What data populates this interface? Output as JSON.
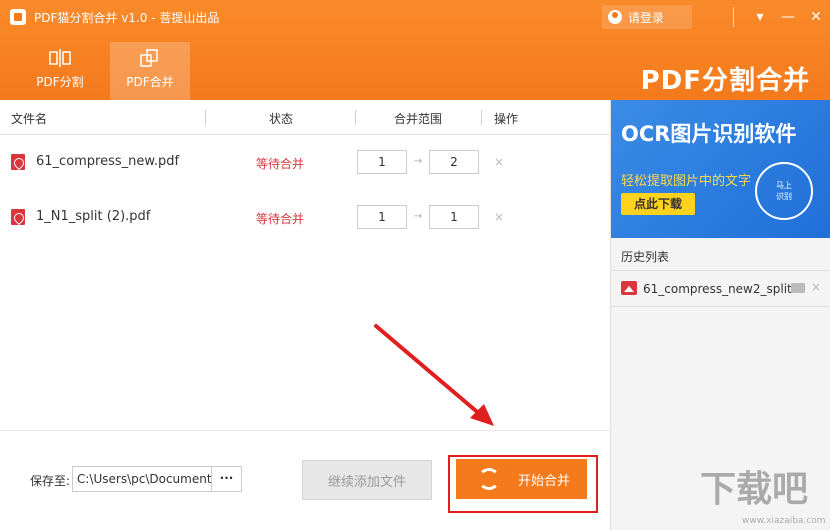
{
  "app": {
    "title": "PDF猫分割合并 v1.0 - 菩提山出品",
    "login_label": "请登录",
    "brand_text": "PDF分割合并"
  },
  "window_controls": [
    "▾",
    "—",
    "✕"
  ],
  "tabs": [
    {
      "label": "PDF分割",
      "icon": "split-icon",
      "active": false
    },
    {
      "label": "PDF合并",
      "icon": "merge-icon",
      "active": true
    }
  ],
  "table": {
    "headers": {
      "filename": "文件名",
      "status": "状态",
      "range": "合并范围",
      "action": "操作"
    },
    "rows": [
      {
        "filename": "61_compress_new.pdf",
        "status": "等待合并",
        "range_from": "1",
        "range_to": "2",
        "delete": "×"
      },
      {
        "filename": "1_N1_split (2).pdf",
        "status": "等待合并",
        "range_from": "1",
        "range_to": "1",
        "delete": "×"
      }
    ]
  },
  "bottom": {
    "save_label": "保存至:",
    "save_path": "C:\\Users\\pc\\Document",
    "more_label": "···",
    "add_button": "继续添加文件",
    "start_button": "开始合并"
  },
  "sidebar": {
    "ad": {
      "title": "OCR图片识别软件",
      "subtitle": "轻松提取图片中的文字",
      "button": "点此下载",
      "badge_line1": "马上",
      "badge_line2": "识别"
    },
    "history_title": "历史列表",
    "history_items": [
      {
        "name": "61_compress_new2_split",
        "close": "×"
      }
    ]
  },
  "watermark": {
    "big": "下载吧",
    "small": "www.xiazaiba.com"
  },
  "colors": {
    "accent": "#f47a1c",
    "status_red": "#d9363e",
    "annotation_red": "#e02020",
    "ad_blue": "#2a7de0"
  }
}
